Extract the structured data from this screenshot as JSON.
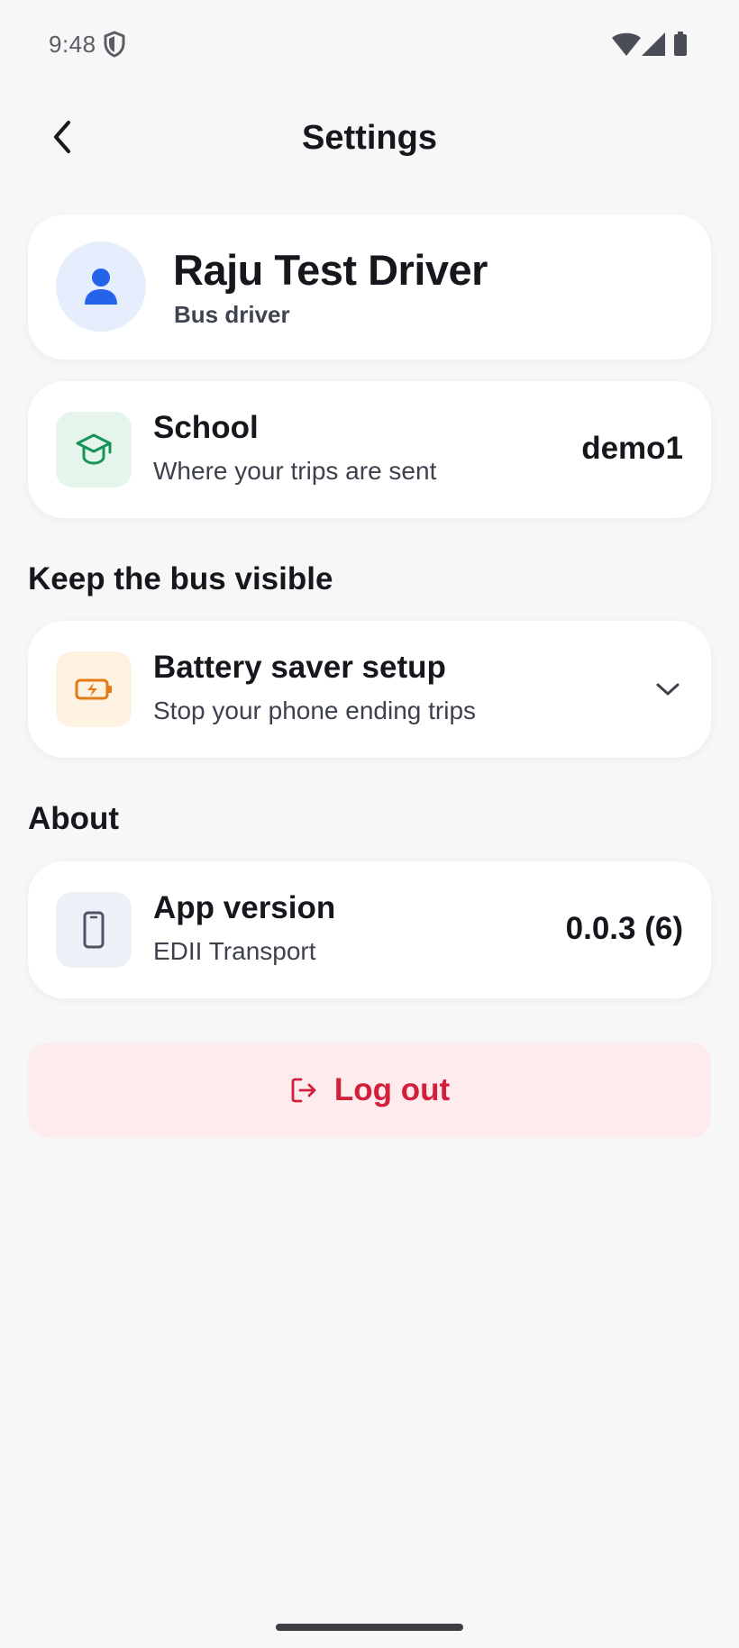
{
  "status_bar": {
    "time": "9:48",
    "icons": [
      "shield-icon",
      "wifi-icon",
      "signal-icon",
      "battery-icon"
    ]
  },
  "header": {
    "title": "Settings",
    "back_icon": "chevron-left-icon"
  },
  "profile": {
    "name": "Raju Test Driver",
    "role": "Bus driver",
    "avatar_icon": "person-icon",
    "accent_color": "#2563EB"
  },
  "school": {
    "title": "School",
    "subtitle": "Where your trips are sent",
    "value": "demo1",
    "icon": "graduation-cap-icon",
    "icon_color": "#17945A"
  },
  "sections": {
    "visibility_heading": "Keep the bus visible",
    "about_heading": "About"
  },
  "battery": {
    "title": "Battery saver setup",
    "subtitle": "Stop your phone ending trips",
    "icon": "battery-charging-icon",
    "icon_color": "#E07B16",
    "expand_icon": "chevron-down-icon"
  },
  "app_version": {
    "title": "App version",
    "subtitle": "EDII Transport",
    "value": "0.0.3 (6)",
    "icon": "phone-icon"
  },
  "logout": {
    "label": "Log out",
    "icon": "logout-icon",
    "color": "#D21F3C"
  }
}
